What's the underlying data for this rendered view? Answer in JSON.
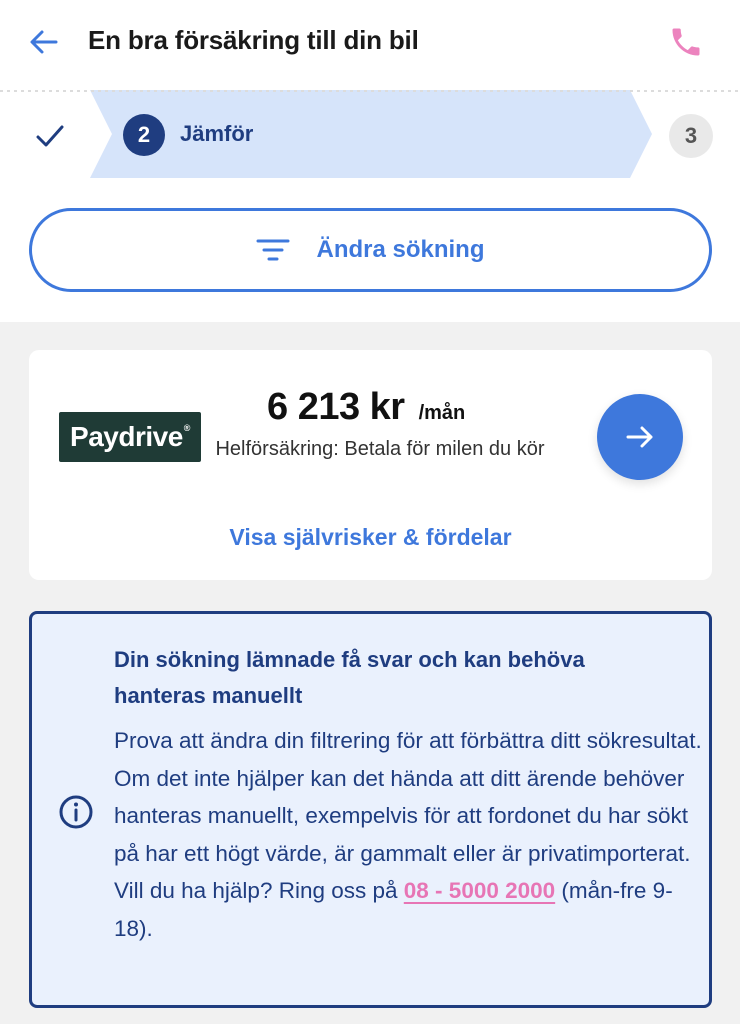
{
  "header": {
    "title": "En bra försäkring till din bil",
    "back_icon": "arrow-left-icon",
    "phone_icon": "phone-icon"
  },
  "stepper": {
    "step1_icon": "checkmark-icon",
    "active_number": "2",
    "active_label": "Jämför",
    "next_number": "3"
  },
  "search": {
    "change_label": "Ändra sökning",
    "filter_icon": "filter-icon"
  },
  "offer": {
    "logo_text": "Paydrive",
    "logo_reg": "®",
    "price": "6 213 kr",
    "price_unit": "/mån",
    "description": "Helförsäkring: Betala för milen du kör",
    "link_label": "Visa självrisker & fördelar",
    "arrow_icon": "arrow-right-icon"
  },
  "info": {
    "title": "Din sökning lämnade få svar och kan behöva hanteras manuellt",
    "body_before": "Prova att ändra din filtrering för att förbättra ditt sökresultat. Om det inte hjälper kan det hända att ditt ärende behöver hanteras manuellt, exempelvis för att fordonet du har sökt på har ett högt värde, är gammalt eller är privatimporterat. Vill du ha hjälp? Ring oss på ",
    "phone": "08 - 5000 2000",
    "body_after": " (mån-fre 9-18).",
    "icon": "info-icon"
  },
  "colors": {
    "accent_blue": "#3e78dc",
    "dark_navy": "#1f3d80",
    "pink": "#e775b5",
    "stepper_active_bg": "#d6e4fa",
    "logo_green": "#1f3b36"
  }
}
